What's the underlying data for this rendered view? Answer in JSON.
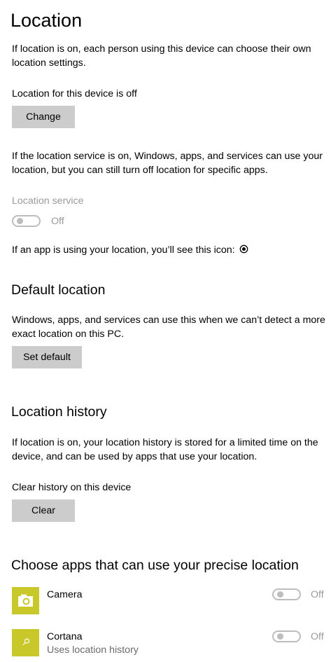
{
  "page": {
    "title": "Location",
    "intro": "If location is on, each person using this device can choose their own location settings.",
    "device_status": "Location for this device is off",
    "change_button": "Change",
    "service_description": "If the location service is on, Windows, apps, and services can use your location, but you can still turn off location for specific apps.",
    "service_label": "Location service",
    "service_state": "Off",
    "icon_note": "If an app is using your location, you’ll see this icon:"
  },
  "default_location": {
    "heading": "Default location",
    "description": "Windows, apps, and services can use this when we can’t detect a more exact location on this PC.",
    "button": "Set default"
  },
  "history": {
    "heading": "Location history",
    "description": "If location is on, your location history is stored for a limited time on the device, and can be used by apps that use your location.",
    "clear_label": "Clear history on this device",
    "clear_button": "Clear"
  },
  "apps_section": {
    "heading": "Choose apps that can use your precise location",
    "apps": [
      {
        "name": "Camera",
        "subtitle": "",
        "icon": "camera-icon",
        "state": "Off"
      },
      {
        "name": "Cortana",
        "subtitle": "Uses location history",
        "icon": "search-icon",
        "state": "Off"
      }
    ]
  },
  "colors": {
    "button_bg": "#cccccc",
    "disabled_text": "#9a9a9a",
    "app_tile": "#c8c82b"
  }
}
